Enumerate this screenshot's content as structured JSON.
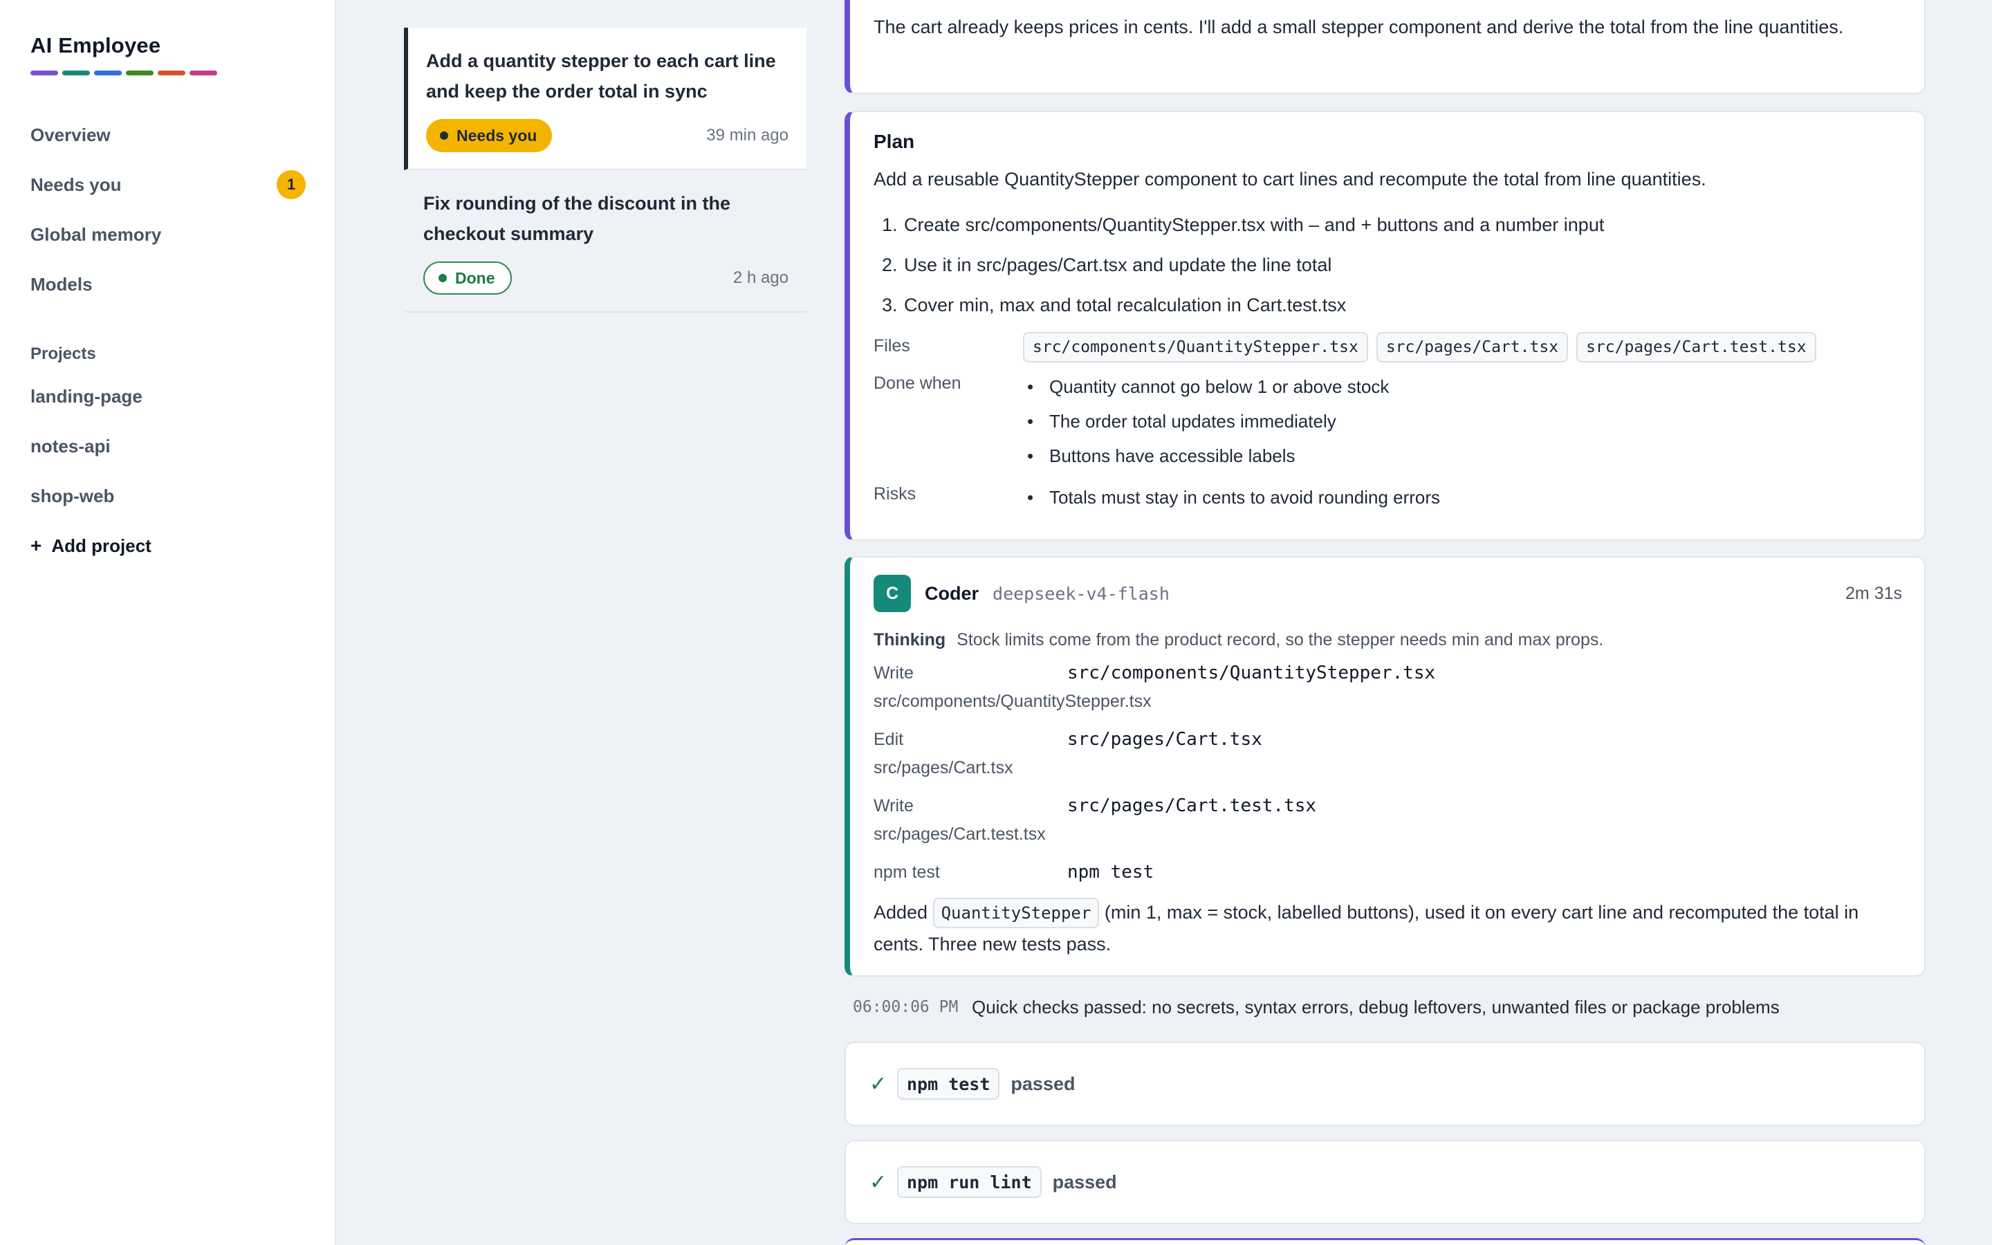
{
  "brand": {
    "title": "AI Employee",
    "bar_colors": [
      "#7b4fd6",
      "#168a7a",
      "#2f6fdc",
      "#3f8a1c",
      "#d2552a",
      "#c43c8a"
    ]
  },
  "nav": {
    "items": [
      {
        "label": "Overview"
      },
      {
        "label": "Needs you",
        "count": "1"
      },
      {
        "label": "Global memory"
      },
      {
        "label": "Models"
      }
    ],
    "projects_label": "Projects",
    "projects": [
      "landing-page",
      "notes-api",
      "shop-web"
    ],
    "add_project": "Add project"
  },
  "tasks": [
    {
      "title": "Add a quantity stepper to each cart line and keep the order total in sync",
      "status": "Needs you",
      "time": "39 min ago"
    },
    {
      "title": "Fix rounding of the discount in the checkout summary",
      "status": "Done",
      "time": "2 h ago"
    }
  ],
  "intro_text": "The cart already keeps prices in cents. I'll add a small stepper component and derive the total from the line quantities.",
  "plan": {
    "title": "Plan",
    "summary": "Add a reusable QuantityStepper component to cart lines and recompute the total from line quantities.",
    "steps": [
      "Create src/components/QuantityStepper.tsx with – and + buttons and a number input",
      "Use it in src/pages/Cart.tsx and update the line total",
      "Cover min, max and total recalculation in Cart.test.tsx"
    ],
    "files_label": "Files",
    "files": [
      "src/components/QuantityStepper.tsx",
      "src/pages/Cart.tsx",
      "src/pages/Cart.test.tsx"
    ],
    "done_label": "Done when",
    "done": [
      "Quantity cannot go below 1 or above stock",
      "The order total updates immediately",
      "Buttons have accessible labels"
    ],
    "risks_label": "Risks",
    "risks": [
      "Totals must stay in cents to avoid rounding errors"
    ]
  },
  "coder": {
    "avatar": "C",
    "name": "Coder",
    "model": "deepseek-v4-flash",
    "duration": "2m 31s",
    "thinking_label": "Thinking",
    "thinking": "Stock limits come from the product record, so the stepper needs min and max props.",
    "actions": [
      {
        "verb": "Write",
        "arg": "src/components/QuantityStepper.tsx",
        "sub": "src/components/QuantityStepper.tsx"
      },
      {
        "verb": "Edit",
        "arg": "src/pages/Cart.tsx",
        "sub": "src/pages/Cart.tsx"
      },
      {
        "verb": "Write",
        "arg": "src/pages/Cart.test.tsx",
        "sub": "src/pages/Cart.test.tsx"
      },
      {
        "verb": "npm test",
        "arg": "npm test",
        "sub": ""
      }
    ],
    "summary_pre": "Added",
    "summary_code": "QuantityStepper",
    "summary_post": "(min 1, max = stock, labelled buttons), used it on every cart line and recomputed the total in cents. Three new tests pass."
  },
  "checks": {
    "time": "06:00:06 PM",
    "text": "Quick checks passed: no secrets, syntax errors, debug leftovers, unwanted files or package problems"
  },
  "tests": [
    {
      "cmd": "npm test",
      "result": "passed"
    },
    {
      "cmd": "npm run lint",
      "result": "passed"
    }
  ]
}
